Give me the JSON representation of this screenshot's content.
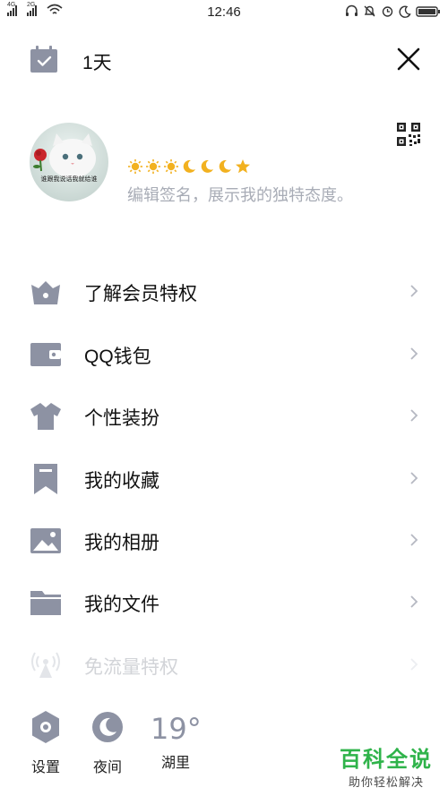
{
  "status_bar": {
    "time": "12:46",
    "signal_1_label": "4G",
    "signal_2_label": "2G"
  },
  "header": {
    "days_label": "1天"
  },
  "profile": {
    "avatar_caption": "谁跟我说话我就给谁",
    "signature_placeholder": "编辑签名，展示我的独特态度。",
    "level_icons": [
      "sun",
      "sun",
      "sun",
      "moon",
      "moon",
      "moon",
      "star"
    ]
  },
  "menu": {
    "items": [
      {
        "label": "了解会员特权",
        "icon": "crown-basket-icon"
      },
      {
        "label": "QQ钱包",
        "icon": "wallet-icon"
      },
      {
        "label": "个性装扮",
        "icon": "tshirt-icon"
      },
      {
        "label": "我的收藏",
        "icon": "bookmark-icon"
      },
      {
        "label": "我的相册",
        "icon": "photo-icon"
      },
      {
        "label": "我的文件",
        "icon": "folder-icon"
      },
      {
        "label": "免流量特权",
        "icon": "antenna-icon"
      }
    ]
  },
  "bottom_bar": {
    "settings_label": "设置",
    "night_label": "夜间",
    "weather_temp": "19°",
    "weather_location": "湖里"
  },
  "watermark": {
    "title": "百科全说",
    "subtitle": "助你轻松解决"
  },
  "colors": {
    "icon_gray": "#8d92a3",
    "text_primary": "#111111",
    "placeholder": "#a8acb6",
    "watermark_green": "#2fb34a"
  }
}
